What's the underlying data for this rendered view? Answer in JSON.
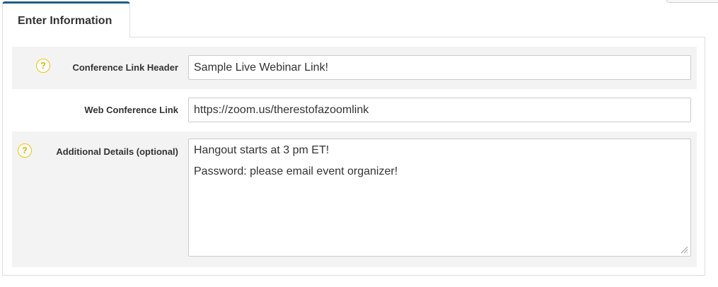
{
  "tab": {
    "label": "Enter Information"
  },
  "form": {
    "conference_link_header": {
      "label": "Conference Link Header",
      "value": "Sample Live Webinar Link!",
      "help_icon": "question-icon"
    },
    "web_conference_link": {
      "label": "Web Conference Link",
      "value": "https://zoom.us/therestofazoomlink"
    },
    "additional_details": {
      "label": "Additional Details (optional)",
      "lines": [
        "Hangout starts at 3 pm ET!",
        "Password: please email event organizer!"
      ],
      "help_icon": "question-icon"
    }
  },
  "colors": {
    "tab_accent": "#1f5c8b",
    "help_icon": "#f2c200",
    "shaded_row": "#f3f3f3",
    "border": "#dddddd"
  }
}
